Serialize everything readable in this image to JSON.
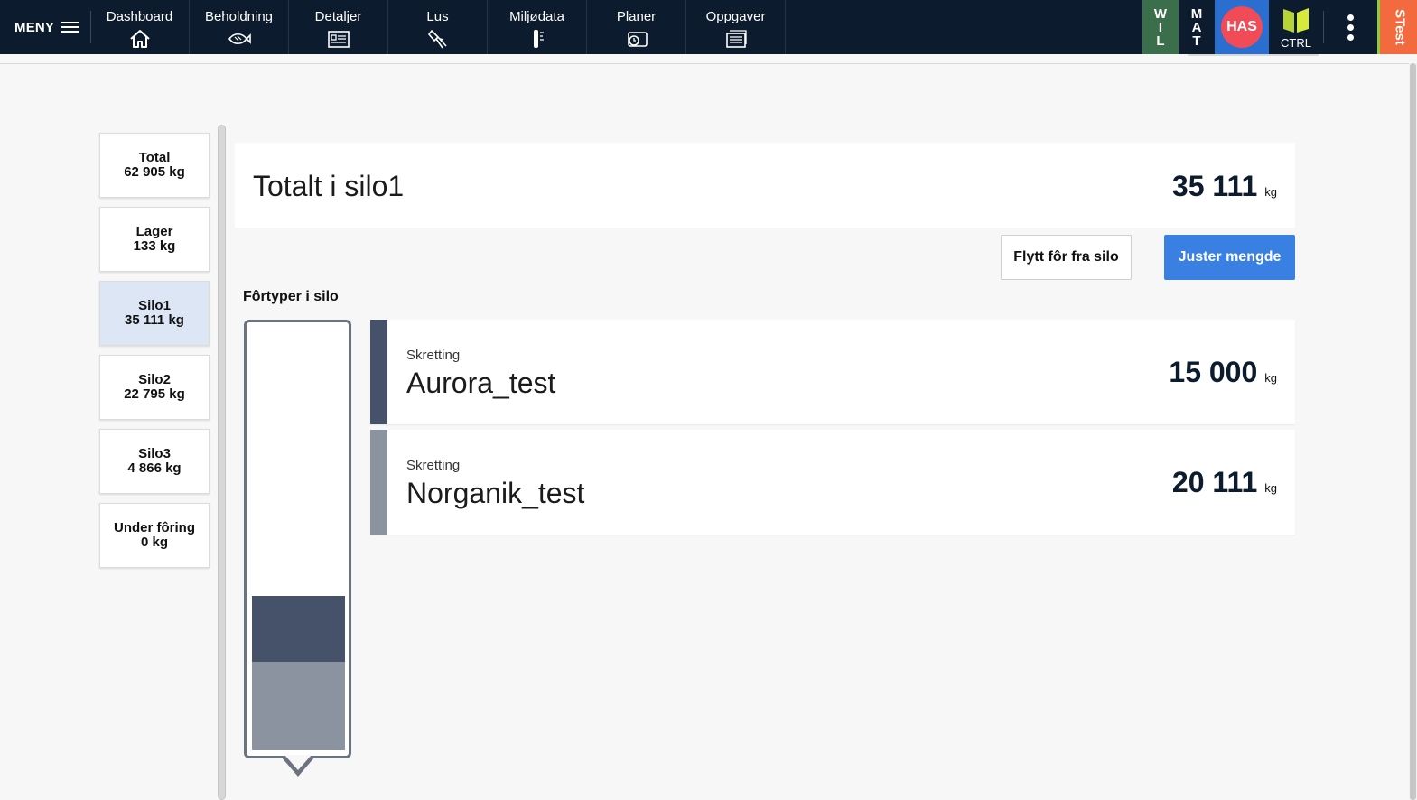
{
  "topbar": {
    "menu_label": "MENY",
    "tabs": [
      {
        "label": "Dashboard",
        "icon": "home-icon"
      },
      {
        "label": "Beholdning",
        "icon": "fish-icon"
      },
      {
        "label": "Detaljer",
        "icon": "details-card-icon"
      },
      {
        "label": "Lus",
        "icon": "lice-icon"
      },
      {
        "label": "Miljødata",
        "icon": "thermometer-icon"
      },
      {
        "label": "Planer",
        "icon": "plans-icon"
      },
      {
        "label": "Oppgaver",
        "icon": "tasks-icon"
      }
    ],
    "wil": [
      "W",
      "I",
      "L"
    ],
    "mat": [
      "M",
      "A",
      "T"
    ],
    "user_initials": "HAS",
    "ctrl_label": "CTRL",
    "env_label": "STest",
    "colors": {
      "bar_bg": "#0c1c2e",
      "wil": "#3b6e4b",
      "has_bg": "#2a6ecf",
      "has_circle": "#f04b57",
      "stest": "#f26a3d"
    }
  },
  "silos": [
    {
      "name": "Total",
      "amount": "62 905 kg",
      "active": false
    },
    {
      "name": "Lager",
      "amount": "133 kg",
      "active": false
    },
    {
      "name": "Silo1",
      "amount": "35 111 kg",
      "active": true
    },
    {
      "name": "Silo2",
      "amount": "22 795 kg",
      "active": false
    },
    {
      "name": "Silo3",
      "amount": "4 866 kg",
      "active": false
    },
    {
      "name": "Under fôring",
      "amount": "0 kg",
      "active": false
    }
  ],
  "summary": {
    "title": "Totalt i silo1",
    "value": "35 111",
    "unit": "kg"
  },
  "actions": {
    "move_label": "Flytt fôr fra silo",
    "adjust_label": "Juster mengde"
  },
  "feed_types": {
    "heading": "Fôrtyper i silo",
    "items": [
      {
        "supplier": "Skretting",
        "name": "Aurora_test",
        "amount": "15 000",
        "unit": "kg",
        "color": "#45526a"
      },
      {
        "supplier": "Skretting",
        "name": "Norganik_test",
        "amount": "20 111",
        "unit": "kg",
        "color": "#8a939f"
      }
    ]
  },
  "gauge": {
    "fill_fraction": 0.36
  }
}
